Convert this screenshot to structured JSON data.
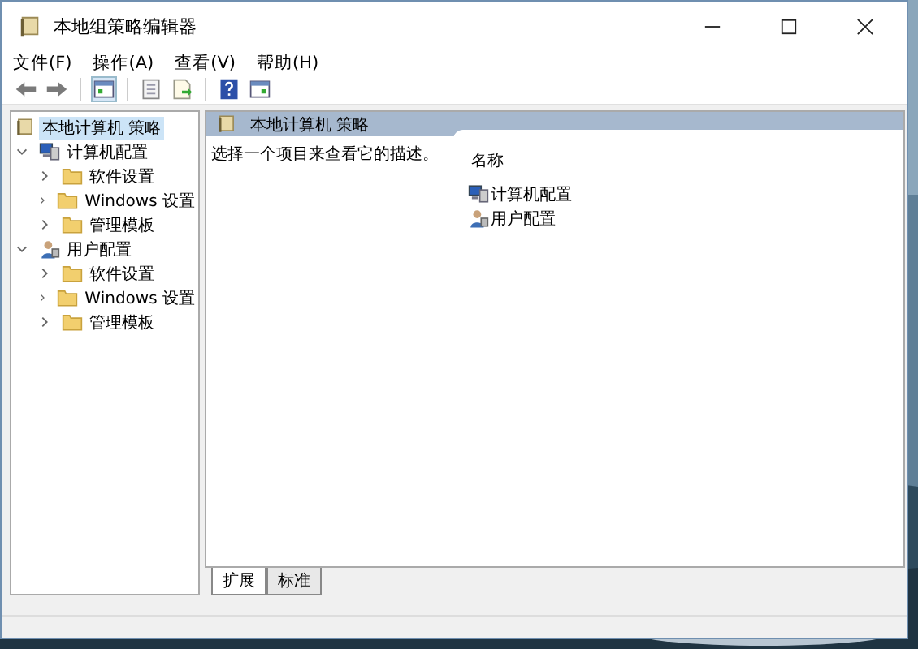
{
  "window": {
    "title": "本地组策略编辑器"
  },
  "menu": [
    {
      "label": "文件(F)"
    },
    {
      "label": "操作(A)"
    },
    {
      "label": "查看(V)"
    },
    {
      "label": "帮助(H)"
    }
  ],
  "toolbar": [
    {
      "kind": "back",
      "disabled": false
    },
    {
      "kind": "forward",
      "disabled": false
    },
    {
      "kind": "sep"
    },
    {
      "kind": "console"
    },
    {
      "kind": "sep"
    },
    {
      "kind": "properties"
    },
    {
      "kind": "export"
    },
    {
      "kind": "sep"
    },
    {
      "kind": "help"
    },
    {
      "kind": "pane"
    }
  ],
  "tree": [
    {
      "label": "本地计算机 策略",
      "kind": "policy",
      "selected": true,
      "children": [
        {
          "label": "计算机配置",
          "kind": "computer",
          "selected": false,
          "expanded": true,
          "children": [
            {
              "label": "软件设置",
              "kind": "folder",
              "selected": false,
              "expanded": false
            },
            {
              "label": "Windows 设置",
              "kind": "folder",
              "selected": false,
              "expanded": false
            },
            {
              "label": "管理模板",
              "kind": "folder",
              "selected": false,
              "expanded": false
            }
          ]
        },
        {
          "label": "用户配置",
          "kind": "user",
          "selected": false,
          "expanded": true,
          "children": [
            {
              "label": "软件设置",
              "kind": "folder",
              "selected": false,
              "expanded": false
            },
            {
              "label": "Windows 设置",
              "kind": "folder",
              "selected": false,
              "expanded": false
            },
            {
              "label": "管理模板",
              "kind": "folder",
              "selected": false,
              "expanded": false
            }
          ]
        }
      ]
    }
  ],
  "detail": {
    "title": "本地计算机 策略",
    "description": "选择一个项目来查看它的描述。",
    "column": "名称",
    "items": [
      {
        "label": "计算机配置",
        "kind": "computer"
      },
      {
        "label": "用户配置",
        "kind": "user"
      }
    ]
  },
  "tabs": [
    {
      "label": "扩展",
      "selected": true
    },
    {
      "label": "标准",
      "selected": false
    }
  ]
}
